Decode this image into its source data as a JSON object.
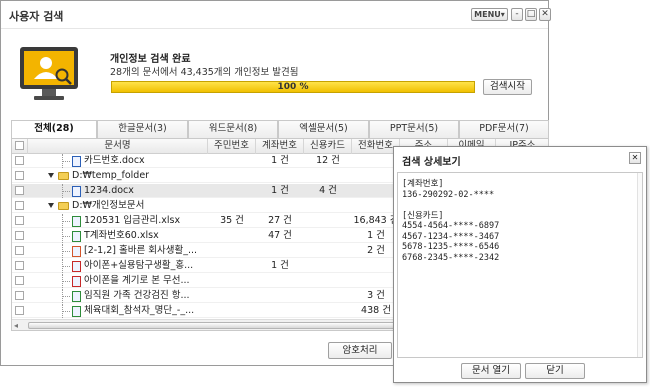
{
  "window": {
    "title": "사용자 검색",
    "menu_label": "MENU▾",
    "help_label": "-",
    "restore_label": "□",
    "close_label": "✕"
  },
  "status": {
    "title": "개인정보 검색 완료",
    "subtitle": "28개의 문서에서 43,435개의 개인정보 발견됨",
    "progress_percent": 100,
    "progress_label": "100 %",
    "search_button": "검색시작"
  },
  "tabs": [
    {
      "label": "전체(28)"
    },
    {
      "label": "한글문서(3)"
    },
    {
      "label": "워드문서(8)"
    },
    {
      "label": "엑셀문서(5)"
    },
    {
      "label": "PPT문서(5)"
    },
    {
      "label": "PDF문서(7)"
    }
  ],
  "table": {
    "columns": [
      "문서명",
      "주민번호",
      "계좌번호",
      "신용카드",
      "전화번호",
      "주소",
      "이메일",
      "IP주소"
    ],
    "rows": [
      {
        "name": "카드번호.docx",
        "type": "W",
        "jumin": "",
        "account": "1 건",
        "card": "12 건",
        "phone": "",
        "selected": false
      },
      {
        "name": "D:₩temp_folder",
        "type": "folder",
        "jumin": "",
        "account": "",
        "card": "",
        "phone": "",
        "selected": false
      },
      {
        "name": "1234.docx",
        "type": "W",
        "jumin": "",
        "account": "1 건",
        "card": "4 건",
        "phone": "",
        "selected": true
      },
      {
        "name": "D:₩개인정보문서",
        "type": "folder",
        "jumin": "",
        "account": "",
        "card": "",
        "phone": "",
        "selected": false
      },
      {
        "name": "120531 입금관리.xlsx",
        "type": "X",
        "jumin": "35 건",
        "account": "27 건",
        "card": "",
        "phone": "16,843 건",
        "selected": false
      },
      {
        "name": "T계좌번호60.xlsx",
        "type": "X",
        "jumin": "",
        "account": "47 건",
        "card": "",
        "phone": "1 건",
        "selected": false
      },
      {
        "name": "[2-1,2] 홀바른 회사생활_...",
        "type": "P",
        "jumin": "",
        "account": "",
        "card": "",
        "phone": "2 건",
        "selected": false
      },
      {
        "name": "아이폰+실용탐구생활_홍...",
        "type": "PDF",
        "jumin": "",
        "account": "1 건",
        "card": "",
        "phone": "",
        "selected": false
      },
      {
        "name": "아이폰을 계기로 본 무선...",
        "type": "PDF",
        "jumin": "",
        "account": "",
        "card": "",
        "phone": "",
        "selected": false
      },
      {
        "name": "임직원 가족 건강검진 항...",
        "type": "X",
        "jumin": "",
        "account": "",
        "card": "",
        "phone": "3 건",
        "selected": false
      },
      {
        "name": "체육대회_참석자_명단_-_...",
        "type": "X",
        "jumin": "",
        "account": "",
        "card": "",
        "phone": "438 건",
        "selected": false
      }
    ]
  },
  "footer": {
    "encrypt_button": "암호처리"
  },
  "popup": {
    "title": "검색 상세보기",
    "lines": [
      "[계좌번호]",
      "136-290292-02-****",
      "",
      "[신용카드]",
      "4554-4564-****-6897",
      "4567-1234-****-3467",
      "5678-1235-****-6546",
      "6768-2345-****-2342"
    ],
    "open_button": "문서 열기",
    "close_button": "닫기",
    "close_icon_label": "✕"
  }
}
